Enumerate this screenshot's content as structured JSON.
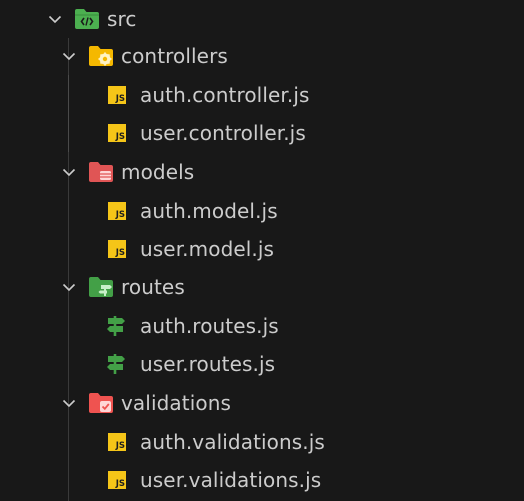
{
  "tree": {
    "root": {
      "label": "src",
      "icon": "folder-src-icon",
      "expanded": true
    },
    "folders": [
      {
        "label": "controllers",
        "icon": "folder-controller-icon",
        "expanded": true,
        "files": [
          {
            "label": "auth.controller.js",
            "icon": "js-file-icon",
            "badge": "JS"
          },
          {
            "label": "user.controller.js",
            "icon": "js-file-icon",
            "badge": "JS"
          }
        ]
      },
      {
        "label": "models",
        "icon": "folder-database-icon",
        "expanded": true,
        "files": [
          {
            "label": "auth.model.js",
            "icon": "js-file-icon",
            "badge": "JS"
          },
          {
            "label": "user.model.js",
            "icon": "js-file-icon",
            "badge": "JS"
          }
        ]
      },
      {
        "label": "routes",
        "icon": "folder-routes-icon",
        "expanded": true,
        "files": [
          {
            "label": "auth.routes.js",
            "icon": "routes-signpost-icon"
          },
          {
            "label": "user.routes.js",
            "icon": "routes-signpost-icon"
          }
        ]
      },
      {
        "label": "validations",
        "icon": "folder-validation-icon",
        "expanded": true,
        "files": [
          {
            "label": "auth.validations.js",
            "icon": "js-file-icon",
            "badge": "JS"
          },
          {
            "label": "user.validations.js",
            "icon": "js-file-icon",
            "badge": "JS"
          }
        ]
      }
    ]
  },
  "colors": {
    "background": "#181818",
    "text": "#cccccc",
    "js_badge": "#f5c518",
    "folder_src": "#4caf50",
    "folder_controllers": "#f5b800",
    "folder_models": "#e05555",
    "folder_routes": "#43a047",
    "folder_validations": "#ef5350"
  }
}
